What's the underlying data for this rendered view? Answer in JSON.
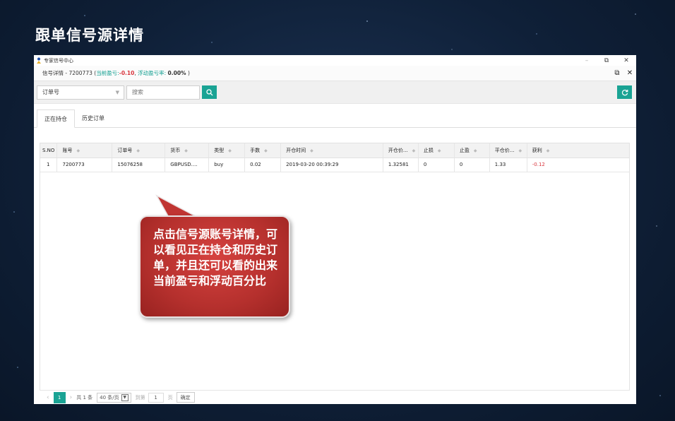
{
  "slide_title": "跟单信号源详情",
  "window": {
    "title": "专家信号中心",
    "minimize": "–",
    "restore": "⧉",
    "close": "✕"
  },
  "detail": {
    "prefix": "信号详情 - 7200773 (",
    "pnl_label": "当前盈亏:",
    "pnl_value": "-0.10",
    "float_label": "浮动盈亏率:",
    "float_value": "0.00%",
    "suffix": ")"
  },
  "toolbar": {
    "select_value": "订单号",
    "search_placeholder": "搜索"
  },
  "tabs": [
    {
      "label": "正在持仓"
    },
    {
      "label": "历史订单"
    }
  ],
  "table": {
    "headers": [
      "S.NO",
      "账号",
      "订单号",
      "货币",
      "类型",
      "手数",
      "开仓时间",
      "开仓价...",
      "止损",
      "止盈",
      "平仓价...",
      "获利"
    ],
    "rows": [
      [
        "1",
        "7200773",
        "15076258",
        "GBPUSD....",
        "buy",
        "0.02",
        "2019-03-20 00:39:29",
        "1.32581",
        "0",
        "0",
        "1.33",
        "-0.12"
      ]
    ]
  },
  "pagination": {
    "current_page": "1",
    "total": "共 1 条",
    "page_size": "40 条/页",
    "goto_label": "到第",
    "goto_value": "1",
    "page_unit": "页",
    "confirm": "确定"
  },
  "callout": {
    "text": "点击信号源账号详情，可以看见正在持仓和历史订单，并且还可以看的出来当前盈亏和浮动百分比"
  },
  "colors": {
    "accent": "#1aa394",
    "negative": "#d9363e",
    "callout": "#c0392b",
    "background": "#0f2038"
  }
}
